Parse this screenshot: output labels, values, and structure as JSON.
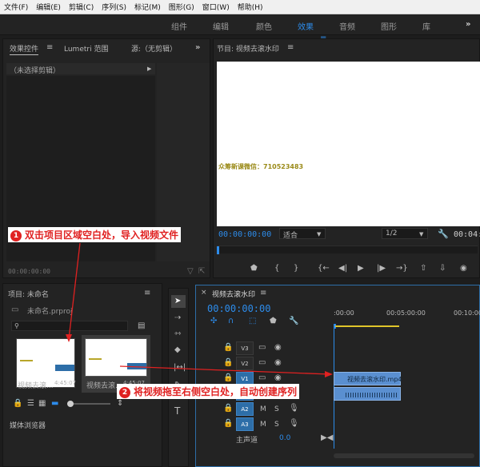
{
  "menu": [
    "文件(F)",
    "编辑(E)",
    "剪辑(C)",
    "序列(S)",
    "标记(M)",
    "图形(G)",
    "窗口(W)",
    "帮助(H)"
  ],
  "workspaces": [
    "组件",
    "编辑",
    "颜色",
    "效果",
    "音频",
    "图形",
    "库"
  ],
  "workspace_active": "效果",
  "effects_panel": {
    "tab_effect_controls": "效果控件",
    "tab_lumetri": "Lumetri 范围",
    "tab_source": "源:（无剪辑）",
    "no_clip": "（未选择剪辑）",
    "timecode": "00:00:00:00"
  },
  "program": {
    "title": "节目: 视频去滚水印",
    "watermark_text": "众筹新课微信：710523483",
    "timecode": "00:00:00:00",
    "fit": "适合",
    "resolution": "1/2",
    "duration": "00:04:"
  },
  "project": {
    "title": "项目: 未命名",
    "file": "未命名.prproj",
    "clips": [
      {
        "name": "视频去滚...",
        "duration": "4:45:07"
      },
      {
        "name": "视频去滚...",
        "duration": "4:45:07"
      }
    ],
    "media_browser": "媒体浏览器"
  },
  "timeline": {
    "title": "视频去滚水印",
    "timecode": "00:00:00:00",
    "ruler": [
      ":00:00",
      "00:05:00:00",
      "00:10:00"
    ],
    "tracks": [
      "V3",
      "V2",
      "V1",
      "A1",
      "A2",
      "A3"
    ],
    "master": "主声道",
    "master_value": "0.0",
    "clip_label": "视频去滚水印.mp4",
    "mute": "M",
    "solo": "S"
  },
  "annotations": {
    "step1_num": "1",
    "step1": "双击项目区域空白处，导入视频文件",
    "step2_num": "2",
    "step2": "将视频拖至右侧空白处，自动创建序列"
  },
  "colors": {
    "accent": "#2d8ceb",
    "callout": "#e02121"
  }
}
